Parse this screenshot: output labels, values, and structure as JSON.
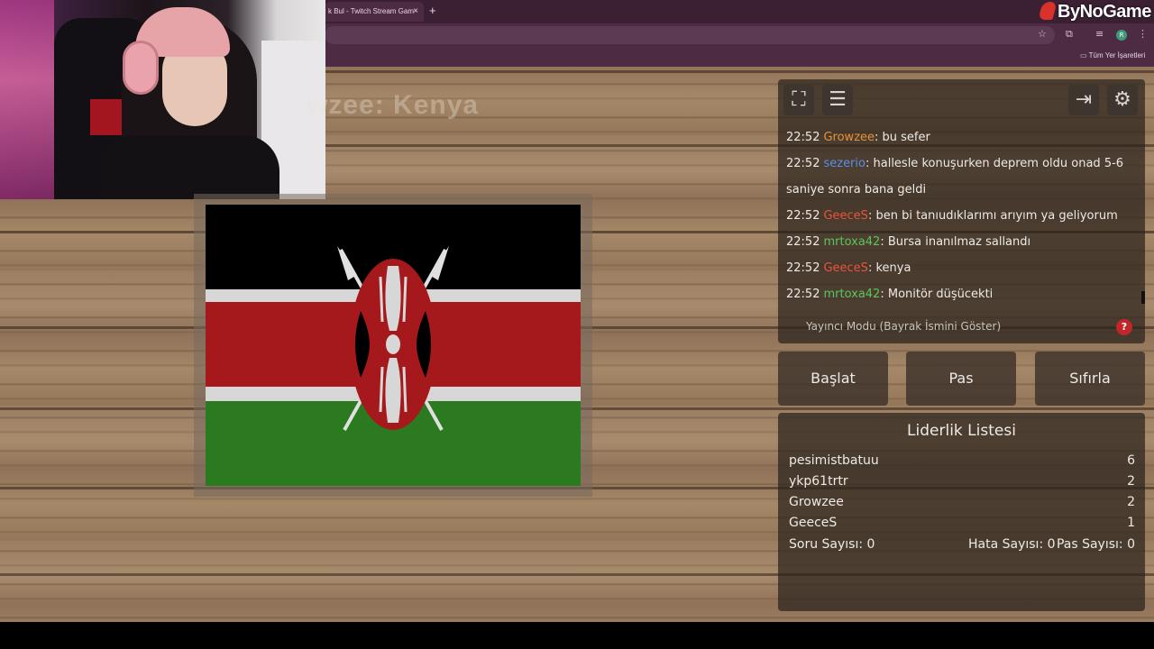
{
  "browser": {
    "tab_title": "k Bul - Twitch Stream Gam",
    "tab_close": "×",
    "new_tab": "+",
    "bookmarks_folder": "Tüm Yer İşaretleri",
    "profile_initial": "R"
  },
  "watermark": {
    "text": "ByNoGame"
  },
  "game": {
    "ghost_title": "wzee: Kenya",
    "flag_country": "Kenya",
    "colors": {
      "black": "#000000",
      "white": "#d7d7d7",
      "red": "#a5191d",
      "green": "#2b7a1f"
    }
  },
  "panel": {
    "icons": [
      "fullscreen-icon",
      "notes-icon",
      "exit-icon",
      "gear-icon"
    ],
    "chat": [
      {
        "time": "22:52",
        "user": "Growzee",
        "color": "#e69138",
        "message": ": bu sefer"
      },
      {
        "time": "22:52",
        "user": "sezerio",
        "color": "#5b8fe6",
        "message": ": hallesle konuşurken deprem oldu onad 5-6 saniye sonra bana geldi"
      },
      {
        "time": "22:52",
        "user": "GeeceS",
        "color": "#e8553c",
        "message": ": ben bi tanıudıklarımı arıyım ya geliyorum"
      },
      {
        "time": "22:52",
        "user": "mrtoxa42",
        "color": "#5cc45a",
        "message": ": Bursa inanılmaz sallandı"
      },
      {
        "time": "22:52",
        "user": "GeeceS",
        "color": "#e8553c",
        "message": ": kenya"
      },
      {
        "time": "22:52",
        "user": "mrtoxa42",
        "color": "#5cc45a",
        "message": ": Monitör düşücekti"
      }
    ],
    "streamer_mode": "Yayıncı Modu (Bayrak İsmini Göster)",
    "help": "?"
  },
  "actions": {
    "start": "Başlat",
    "pass": "Pas",
    "reset": "Sıfırla"
  },
  "leaderboard": {
    "title": "Liderlik Listesi",
    "rows": [
      {
        "name": "pesimistbatuu",
        "score": "6"
      },
      {
        "name": "ykp61trtr",
        "score": "2"
      },
      {
        "name": "Growzee",
        "score": "2"
      },
      {
        "name": "GeeceS",
        "score": "1"
      }
    ],
    "stats": {
      "questions": "Soru Sayısı: 0",
      "errors": "Hata Sayısı: 0",
      "passes": "Pas Sayısı: 0"
    }
  }
}
